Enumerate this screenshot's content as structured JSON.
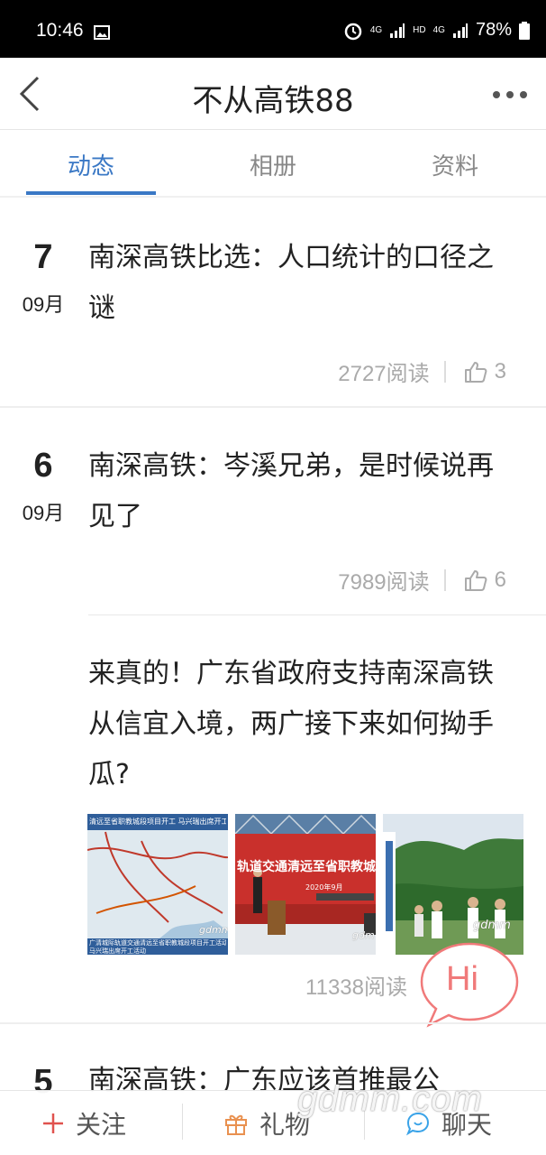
{
  "status_bar": {
    "time": "10:46",
    "net1": "4G",
    "hd": "HD",
    "net2": "4G",
    "battery": "78%"
  },
  "nav": {
    "title": "不从高铁88"
  },
  "tabs": [
    {
      "label": "动态",
      "active": true
    },
    {
      "label": "相册",
      "active": false
    },
    {
      "label": "资料",
      "active": false
    }
  ],
  "posts": [
    {
      "day": "7",
      "month": "09月",
      "title": "南深高铁比选：人口统计的口径之谜",
      "reads": "2727阅读",
      "likes": "3"
    },
    {
      "day": "6",
      "month": "09月",
      "title": "南深高铁：岑溪兄弟，是时候说再见了",
      "reads": "7989阅读",
      "likes": "6"
    },
    {
      "title": "来真的！广东省政府支持南深高铁从信宜入境，两广接下来如何拗手瓜?",
      "reads": "11338阅读"
    },
    {
      "day": "5",
      "title": "南深高铁：广东应该首推最公"
    }
  ],
  "photos": {
    "p1": {
      "banner": "清远至省职教城段项目开工 马兴瑞出席开工",
      "caption": "广清城际轨道交通清远至省职教城段项目开工活动",
      "caption2": "马兴瑞出席开工活动",
      "wm": "gdmm"
    },
    "p2": {
      "banner": "轨道交通清远至省职教城",
      "date": "2020年9月",
      "wm": "gdm"
    },
    "p3": {
      "wm": "gdmm"
    }
  },
  "hi_bubble": "Hi",
  "bottom_bar": {
    "follow": "关注",
    "gift": "礼物",
    "chat": "聊天",
    "watermark": "gdmm.com"
  },
  "colors": {
    "accent": "#3a78c5",
    "follow_icon": "#e0524e",
    "gift_icon": "#e99150",
    "chat_icon": "#3aa3e8",
    "hi": "#f07a7a"
  }
}
